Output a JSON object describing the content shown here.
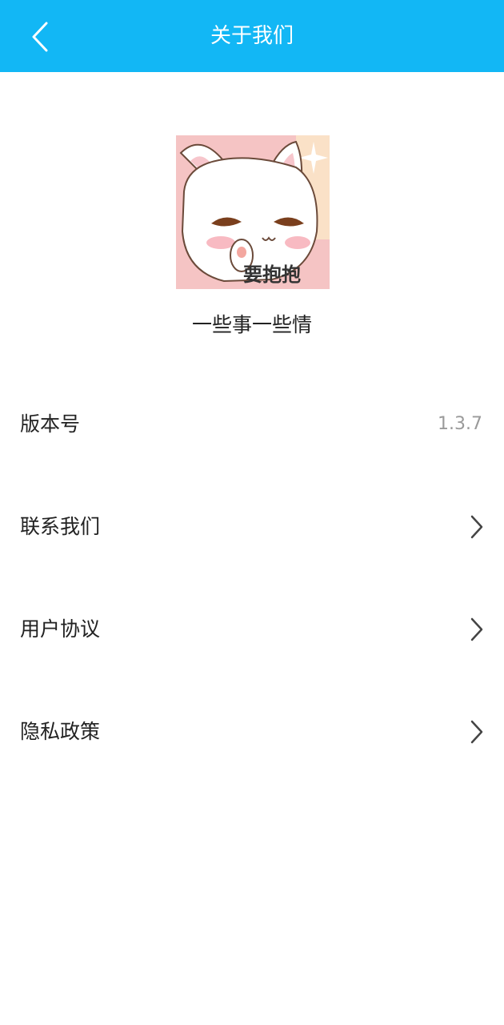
{
  "header": {
    "title": "关于我们",
    "back_icon": "chevron-left-icon",
    "background_color": "#12b7f5"
  },
  "app": {
    "logo_caption": "要抱抱",
    "name": "一些事一些情"
  },
  "rows": [
    {
      "label": "版本号",
      "value": "1.3.7"
    },
    {
      "label": "联系我们",
      "icon": "chevron-right-icon"
    },
    {
      "label": "用户协议",
      "icon": "chevron-right-icon"
    },
    {
      "label": "隐私政策",
      "icon": "chevron-right-icon"
    }
  ]
}
